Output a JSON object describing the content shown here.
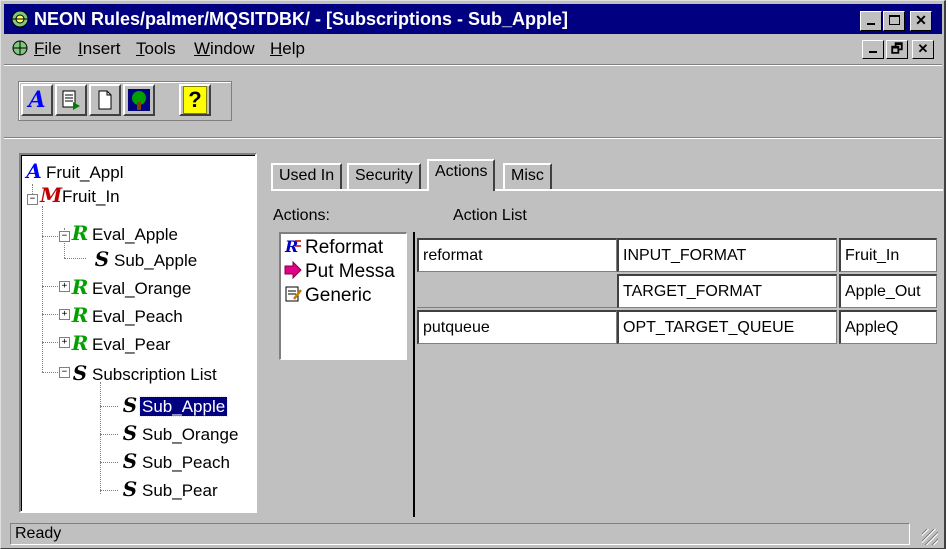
{
  "window": {
    "title": "NEON Rules/palmer/MQSITDBK/ - [Subscriptions - Sub_Apple]",
    "caption_buttons": [
      "minimize-icon",
      "maximize-icon",
      "close-icon"
    ]
  },
  "menu": {
    "items": [
      {
        "label": "File",
        "accel": "F"
      },
      {
        "label": "Insert",
        "accel": "I"
      },
      {
        "label": "Tools",
        "accel": "T"
      },
      {
        "label": "Window",
        "accel": "W"
      },
      {
        "label": "Help",
        "accel": "H"
      }
    ]
  },
  "toolbar": {
    "buttons": [
      "rules-icon",
      "document-run-icon",
      "new-document-icon",
      "tree-map-icon",
      "help-icon"
    ]
  },
  "tree": {
    "root": "Fruit_Appl",
    "nodes": [
      {
        "label": "Fruit_Appl",
        "icon": "A"
      },
      {
        "label": "Fruit_In",
        "icon": "M"
      },
      {
        "label": "Eval_Apple",
        "icon": "R"
      },
      {
        "label": "Sub_Apple",
        "icon": "S"
      },
      {
        "label": "Eval_Orange",
        "icon": "R"
      },
      {
        "label": "Eval_Peach",
        "icon": "R"
      },
      {
        "label": "Eval_Pear",
        "icon": "R"
      },
      {
        "label": "Subscription List",
        "icon": "S"
      },
      {
        "label": "Sub_Apple",
        "icon": "S",
        "selected": true
      },
      {
        "label": "Sub_Orange",
        "icon": "S"
      },
      {
        "label": "Sub_Peach",
        "icon": "S"
      },
      {
        "label": "Sub_Pear",
        "icon": "S"
      }
    ]
  },
  "tabs": [
    {
      "label": "Used In"
    },
    {
      "label": "Security"
    },
    {
      "label": "Actions",
      "active": true
    },
    {
      "label": "Misc"
    }
  ],
  "actions": {
    "label": "Actions:",
    "list_label": "Action List",
    "items": [
      {
        "label": "Reformat",
        "icon": "reformat-icon"
      },
      {
        "label": "Put Messa",
        "icon": "put-message-icon"
      },
      {
        "label": "Generic",
        "icon": "generic-icon"
      }
    ],
    "rows": [
      {
        "action": "reformat",
        "param": "INPUT_FORMAT",
        "value": "Fruit_In"
      },
      {
        "action": "",
        "param": "TARGET_FORMAT",
        "value": "Apple_Out"
      },
      {
        "action": "putqueue",
        "param": "OPT_TARGET_QUEUE",
        "value": "AppleQ"
      }
    ]
  },
  "status": {
    "text": "Ready"
  }
}
